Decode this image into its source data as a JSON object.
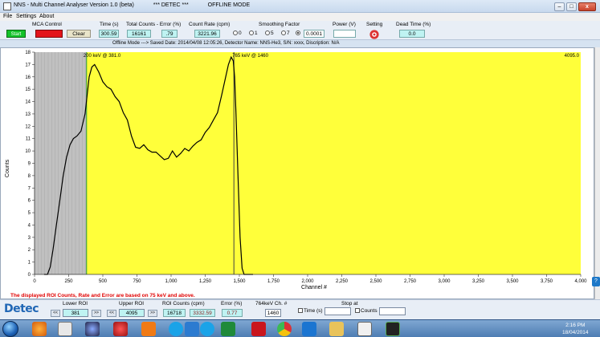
{
  "window": {
    "title": "NNS - Multi Channel Analyser Version 1.0 (beta)",
    "brand": "*** DETEC ***",
    "mode": "OFFLINE MODE",
    "min_glyph": "–",
    "max_glyph": "□",
    "close_glyph": "x"
  },
  "menu": {
    "file": "File",
    "settings": "Settings",
    "about": "About"
  },
  "controls": {
    "mca_label": "MCA Control",
    "start_label": "Start",
    "clear_label": "Clear",
    "time_label": "Time (s)",
    "time_value": "300.59",
    "total_label": "Total Counts - Error (%)",
    "total_value": "16161",
    "total_error": ".79",
    "rate_label": "Count Rate (cpm)",
    "rate_value": "3221.96",
    "smoothing_label": "Smoothing Factor",
    "smoothing_options": [
      "0",
      "1",
      "5",
      "7"
    ],
    "smoothing_value": "0.0001",
    "power_label": "Power (V)",
    "setting_label": "Setting",
    "dead_label": "Dead Time (%)",
    "dead_value": "0.0"
  },
  "status": "Offline Mode ---> Saved Date: 2014/04/08 12:05:26, Detector Name: NNS-He3, S/N: xxxx, Discription: N/A",
  "plot": {
    "ylabel": "Counts",
    "xlabel": "Channel #",
    "left_cursor": "200 keV @ 381.0",
    "right_cursor": "765 keV @ 1460",
    "right_edge": "4095.0",
    "note": "The displayed ROI Counts, Rate and Error are based on  75 keV and above.",
    "colors": {
      "roi": "#ffff3a",
      "below": "#c0c0c0",
      "trace": "#000000",
      "note": "#e00000"
    }
  },
  "chart_data": {
    "type": "line",
    "xlabel": "Channel #",
    "ylabel": "Counts",
    "xlim": [
      0,
      4000
    ],
    "ylim": [
      0,
      18
    ],
    "xticks": [
      "0",
      "250",
      "500",
      "750",
      "1,000",
      "1,250",
      "1,500",
      "1,750",
      "2,000",
      "2,250",
      "2,500",
      "2,750",
      "3,000",
      "3,250",
      "3,500",
      "3,750",
      "4,000"
    ],
    "yticks": [
      "0",
      "1",
      "2",
      "3",
      "4",
      "5",
      "6",
      "7",
      "8",
      "9",
      "10",
      "11",
      "12",
      "13",
      "14",
      "15",
      "16",
      "17",
      "18"
    ],
    "shaded_gray": [
      0,
      381
    ],
    "shaded_yellow": [
      381,
      4095
    ],
    "markers": [
      381,
      1460
    ],
    "x": [
      70,
      95,
      115,
      135,
      160,
      185,
      210,
      235,
      260,
      285,
      310,
      340,
      370,
      400,
      420,
      440,
      470,
      500,
      530,
      560,
      590,
      620,
      650,
      680,
      710,
      740,
      770,
      800,
      830,
      860,
      890,
      920,
      950,
      980,
      1010,
      1040,
      1070,
      1100,
      1130,
      1160,
      1190,
      1220,
      1250,
      1280,
      1310,
      1340,
      1370,
      1400,
      1420,
      1440,
      1455,
      1465,
      1475,
      1490,
      1505,
      1520,
      1535,
      1550,
      1565,
      1580,
      1600
    ],
    "values": [
      0,
      0,
      0.6,
      2.0,
      4.0,
      6.0,
      8.0,
      9.5,
      10.5,
      11.0,
      11.2,
      11.6,
      13.0,
      16.0,
      16.8,
      17.0,
      16.4,
      15.6,
      15.2,
      15.0,
      14.4,
      14.0,
      13.1,
      12.5,
      11.2,
      10.3,
      10.2,
      10.5,
      10.1,
      9.9,
      9.9,
      9.6,
      9.3,
      9.4,
      10.0,
      9.5,
      9.8,
      10.2,
      10.0,
      10.4,
      10.7,
      10.9,
      11.5,
      11.9,
      12.5,
      13.1,
      14.5,
      16.0,
      17.0,
      17.6,
      17.3,
      16.0,
      13.0,
      8.0,
      3.0,
      0.5,
      0,
      0,
      0,
      0,
      0
    ]
  },
  "bottom": {
    "logo": "Detec",
    "lower_roi_label": "Lower ROI",
    "lower_roi_value": "381",
    "upper_roi_label": "Upper ROI",
    "upper_roi_value": "4095",
    "roi_counts_label": "ROI Counts",
    "roi_counts_value": "16718",
    "roi_cpm_label": "(cpm)",
    "roi_cpm_value": "3332.59",
    "roi_error_label": "Error (%)",
    "roi_error_value": "0.77",
    "ch_label": "764keV Ch. #",
    "ch_value": "1460",
    "stop_label": "Stop at",
    "time_chk": "Time (s)",
    "counts_chk": "Counts",
    "left_arrow": "<<",
    "right_arrow": ">>"
  },
  "taskbar": {
    "time": "2:16 PM",
    "date": "18/04/2014",
    "help_glyph": "?",
    "icons": [
      "firefox-icon",
      "app-icon",
      "media-icon",
      "pin-icon",
      "play-icon",
      "skype-icon",
      "app-blue-icon",
      "skype-icon-2",
      "excel-icon",
      "pdf-icon",
      "chrome-icon",
      "teamviewer-icon",
      "folder-icon",
      "explorer-icon",
      "monitor-icon"
    ]
  }
}
